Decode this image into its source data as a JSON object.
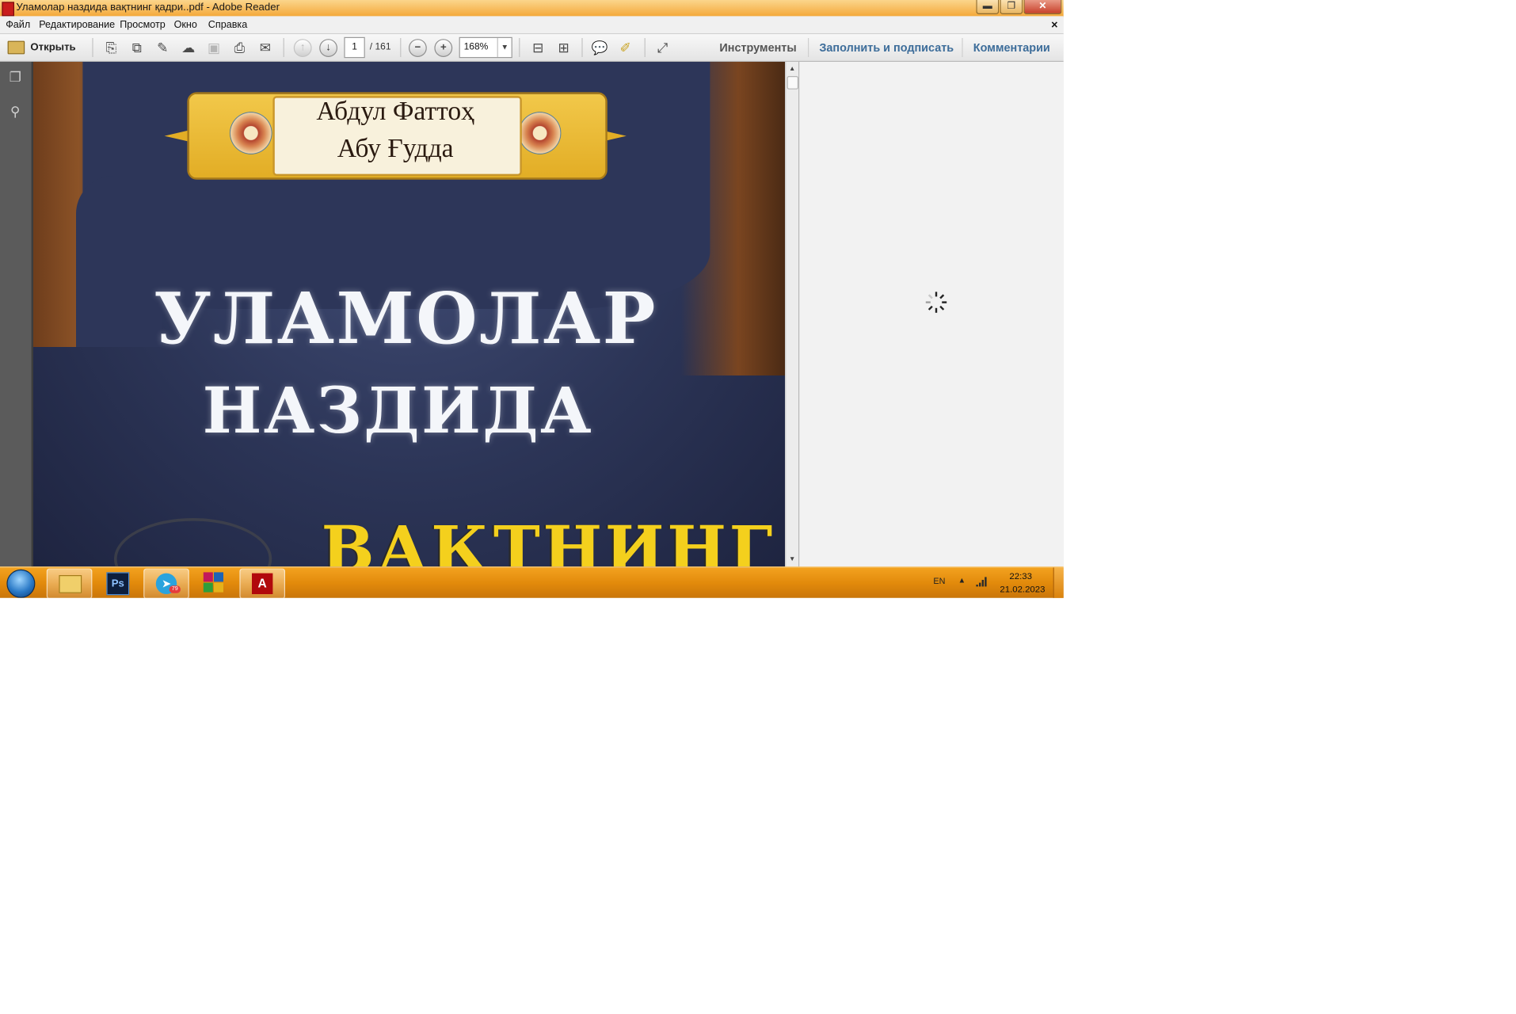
{
  "window": {
    "title": "Уламолар наздида вақтнинг қадри..pdf - Adobe Reader",
    "minimize_label": "▬",
    "maximize_label": "❐",
    "close_label": "✕"
  },
  "menu": {
    "items": [
      "Файл",
      "Редактирование",
      "Просмотр",
      "Окно",
      "Справка"
    ],
    "close_label": "×"
  },
  "toolbar": {
    "open_label": "Открыть",
    "page_current": "1",
    "page_total": "/ 161",
    "zoom": "168%",
    "tools_label": "Инструменты",
    "fill_sign_label": "Заполнить и подписать",
    "comments_label": "Комментарии"
  },
  "document": {
    "author_line1": "Абдул Фаттоҳ",
    "author_line2": "Абу Ғудда",
    "title_line1": "УЛАМОЛАР",
    "title_line2": "НАЗДИДА",
    "title_line3": "ВАҚТНИНГ"
  },
  "taskbar": {
    "telegram_badge": "79",
    "photoshop_label": "Ps",
    "language": "EN",
    "tray_arrow": "▲",
    "time": "22:33",
    "date": "21.02.2023"
  },
  "colors": {
    "title_bar": "#f4a93a",
    "taskbar": "#e28a0b",
    "accent_blue_tab": "#3d6d9a",
    "cover_navy": "#2c3557",
    "cover_yellow_text": "#f4d01d"
  }
}
